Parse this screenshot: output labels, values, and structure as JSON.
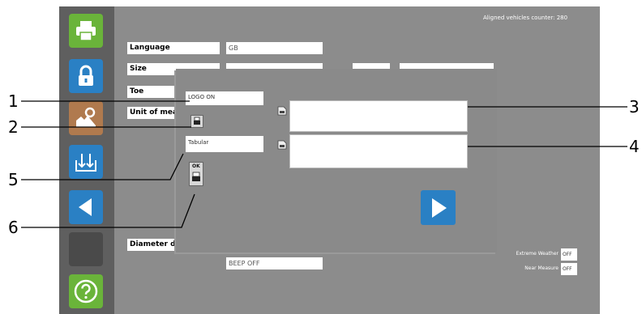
{
  "header": {
    "counter_text": "Aligned vehicles counter: 280"
  },
  "sidebar": {
    "items": [
      {
        "icon": "printer-icon",
        "color": "#6ab43a"
      },
      {
        "icon": "lock-icon",
        "color": "#2a80c4"
      },
      {
        "icon": "setup-icon",
        "color": "#b07a4e"
      },
      {
        "icon": "download-icon",
        "color": "#2a80c4"
      },
      {
        "icon": "back-icon",
        "color": "#2a80c4"
      },
      {
        "icon": "blank",
        "color": "#4a4a4a"
      },
      {
        "icon": "help-icon",
        "color": "#6ab43a"
      }
    ]
  },
  "settings": {
    "language_label": "Language",
    "language_value": "GB",
    "size_label": "Size",
    "toe_label": "Toe",
    "unit_label": "Unit of measu",
    "diameter_label": "Diameter diffe",
    "beep_value": "BEEP OFF"
  },
  "options": {
    "extreme_weather_label": "Extreme Weather",
    "extreme_weather_value": "OFF",
    "near_measure_label": "Near Measure",
    "near_measure_value": "OFF"
  },
  "dialog": {
    "logo_field": "LOGO ON",
    "layout_field": "Tabular",
    "ok_label": "OK"
  },
  "callouts": {
    "labels": [
      "1",
      "2",
      "3",
      "4",
      "5",
      "6"
    ]
  },
  "colors": {
    "accent": "#2a80c4",
    "panel": "#8c8c8c",
    "sidebar": "#5f5f5f"
  }
}
